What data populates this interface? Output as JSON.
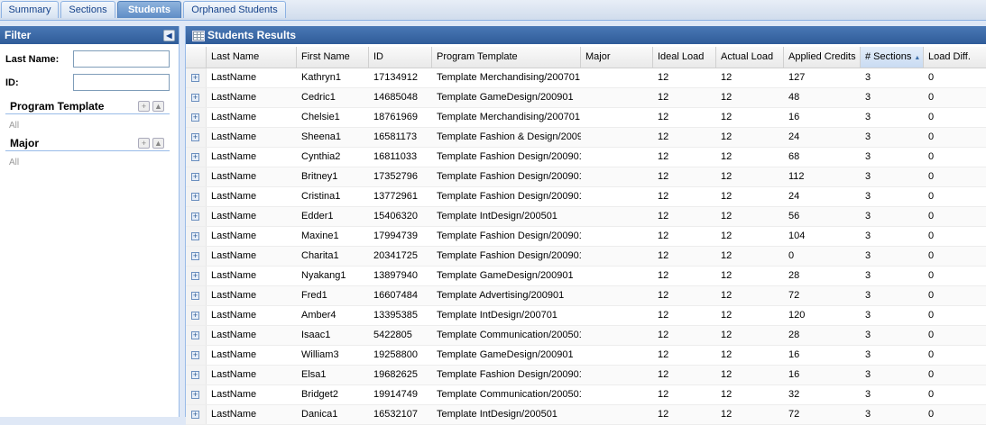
{
  "tabs": [
    {
      "label": "Summary",
      "active": false
    },
    {
      "label": "Sections",
      "active": false
    },
    {
      "label": "Students",
      "active": true
    },
    {
      "label": "Orphaned Students",
      "active": false
    }
  ],
  "filter": {
    "title": "Filter",
    "collapse_icon": "collapse-left-icon",
    "last_name_label": "Last Name:",
    "last_name_value": "",
    "id_label": "ID:",
    "id_value": "",
    "program_template_title": "Program Template",
    "program_template_value": "All",
    "major_title": "Major",
    "major_value": "All"
  },
  "results": {
    "title": "Students Results",
    "columns": [
      "Last Name",
      "First Name",
      "ID",
      "Program Template",
      "Major",
      "Ideal Load",
      "Actual Load",
      "Applied Credits",
      "# Sections",
      "Load Diff."
    ],
    "sorted_column": "# Sections",
    "sort_direction": "ascending",
    "rows": [
      [
        "LastName",
        "Kathryn1",
        "17134912",
        "Template Merchandising/200701",
        "",
        "12",
        "12",
        "127",
        "3",
        "0"
      ],
      [
        "LastName",
        "Cedric1",
        "14685048",
        "Template GameDesign/200901",
        "",
        "12",
        "12",
        "48",
        "3",
        "0"
      ],
      [
        "LastName",
        "Chelsie1",
        "18761969",
        "Template Merchandising/200701",
        "",
        "12",
        "12",
        "16",
        "3",
        "0"
      ],
      [
        "LastName",
        "Sheena1",
        "16581173",
        "Template Fashion & Design/20090",
        "",
        "12",
        "12",
        "24",
        "3",
        "0"
      ],
      [
        "LastName",
        "Cynthia2",
        "16811033",
        "Template Fashion Design/200901",
        "",
        "12",
        "12",
        "68",
        "3",
        "0"
      ],
      [
        "LastName",
        "Britney1",
        "17352796",
        "Template Fashion Design/200901",
        "",
        "12",
        "12",
        "112",
        "3",
        "0"
      ],
      [
        "LastName",
        "Cristina1",
        "13772961",
        "Template Fashion Design/200901",
        "",
        "12",
        "12",
        "24",
        "3",
        "0"
      ],
      [
        "LastName",
        "Edder1",
        "15406320",
        "Template IntDesign/200501",
        "",
        "12",
        "12",
        "56",
        "3",
        "0"
      ],
      [
        "LastName",
        "Maxine1",
        "17994739",
        "Template Fashion Design/200901",
        "",
        "12",
        "12",
        "104",
        "3",
        "0"
      ],
      [
        "LastName",
        "Charita1",
        "20341725",
        "Template Fashion Design/200901",
        "",
        "12",
        "12",
        "0",
        "3",
        "0"
      ],
      [
        "LastName",
        "Nyakang1",
        "13897940",
        "Template GameDesign/200901",
        "",
        "12",
        "12",
        "28",
        "3",
        "0"
      ],
      [
        "LastName",
        "Fred1",
        "16607484",
        "Template Advertising/200901",
        "",
        "12",
        "12",
        "72",
        "3",
        "0"
      ],
      [
        "LastName",
        "Amber4",
        "13395385",
        "Template IntDesign/200701",
        "",
        "12",
        "12",
        "120",
        "3",
        "0"
      ],
      [
        "LastName",
        "Isaac1",
        "5422805",
        "Template Communication/200501",
        "",
        "12",
        "12",
        "28",
        "3",
        "0"
      ],
      [
        "LastName",
        "William3",
        "19258800",
        "Template GameDesign/200901",
        "",
        "12",
        "12",
        "16",
        "3",
        "0"
      ],
      [
        "LastName",
        "Elsa1",
        "19682625",
        "Template Fashion Design/200901",
        "",
        "12",
        "12",
        "16",
        "3",
        "0"
      ],
      [
        "LastName",
        "Bridget2",
        "19914749",
        "Template Communication/200501",
        "",
        "12",
        "12",
        "32",
        "3",
        "0"
      ],
      [
        "LastName",
        "Danica1",
        "16532107",
        "Template IntDesign/200501",
        "",
        "12",
        "12",
        "72",
        "3",
        "0"
      ]
    ]
  }
}
